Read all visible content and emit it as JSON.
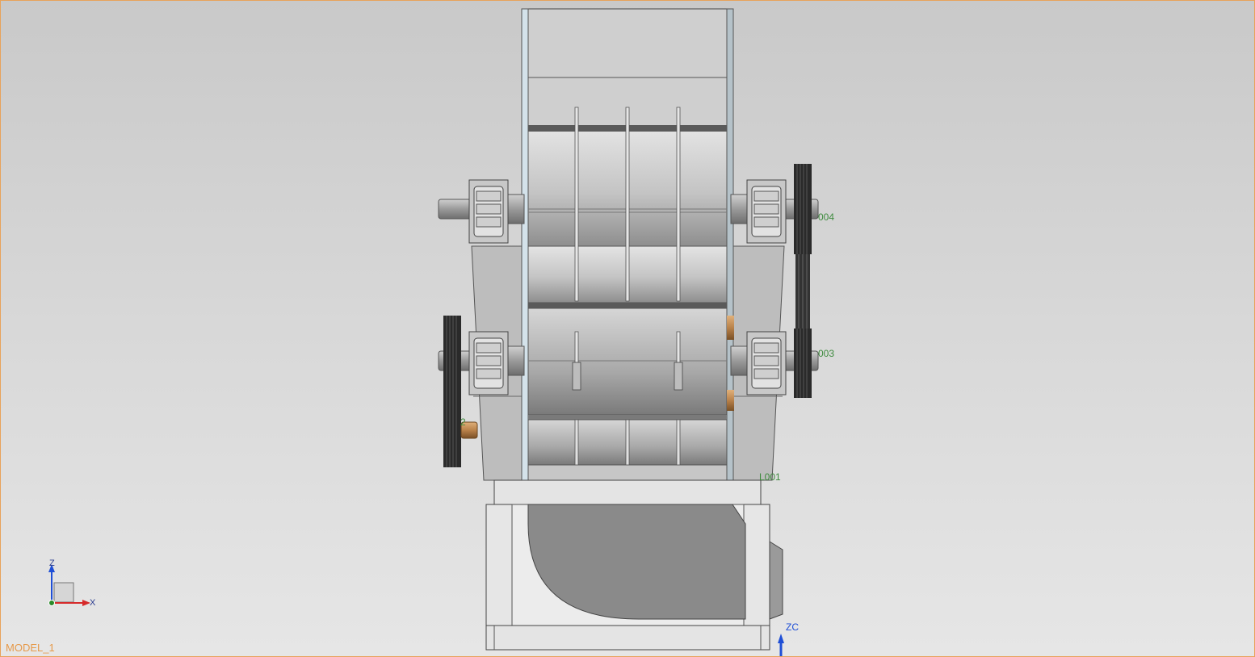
{
  "view": {
    "model_name": "MODEL_1",
    "part_labels": [
      "004",
      "003",
      "2",
      "L001"
    ],
    "triad": {
      "z": "Z",
      "x": "X"
    },
    "work_axis": "ZC"
  },
  "colors": {
    "background_top": "#c9c9c9",
    "background_bottom": "#e6e6e6",
    "frame_border": "#e8a25a",
    "label_green": "#3e8b3e",
    "model_name_orange": "#e69a4a",
    "axis_blue": "#1f4fd6",
    "axis_red": "#d62a2a",
    "bronze": "#b9824a"
  }
}
